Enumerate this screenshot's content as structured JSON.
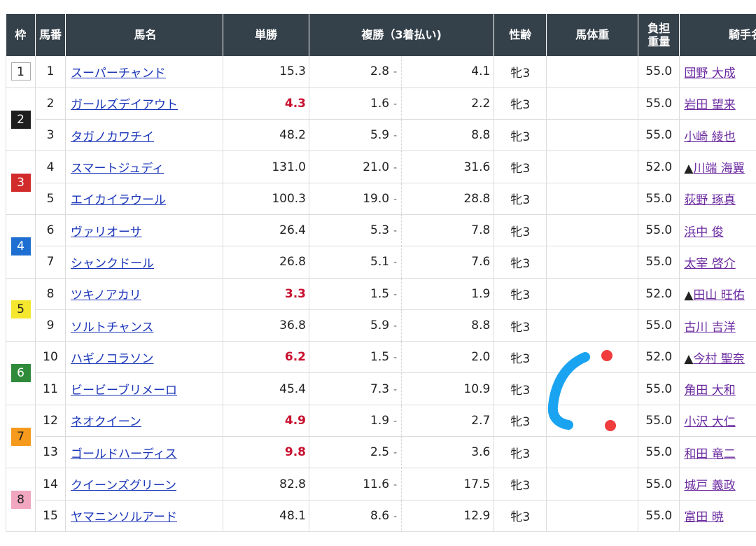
{
  "headers": {
    "waku": "枠",
    "num": "馬番",
    "name": "馬名",
    "win": "単勝",
    "place": "複勝（3着払い)",
    "sex_age": "性齢",
    "body_weight": "馬体重",
    "burden_line1": "負担",
    "burden_line2": "重量",
    "jockey": "騎手名"
  },
  "colors": {
    "header_bg": "#35414a",
    "horse_link": "#1a35b8",
    "jockey_link": "#6b2aa0",
    "favorite_odds": "#c8102e",
    "annotation_blue": "#1aa3f0",
    "annotation_red": "#f03c3c"
  },
  "waku_groups": [
    {
      "label": "1",
      "bg": "#ffffff",
      "fg": "#222222",
      "border": "#aaaaaa",
      "rows": 1
    },
    {
      "label": "2",
      "bg": "#1f1f1f",
      "fg": "#ffffff",
      "border": "none",
      "rows": 2
    },
    {
      "label": "3",
      "bg": "#d12b2b",
      "fg": "#ffffff",
      "border": "none",
      "rows": 2
    },
    {
      "label": "4",
      "bg": "#1e6fd1",
      "fg": "#ffffff",
      "border": "none",
      "rows": 2
    },
    {
      "label": "5",
      "bg": "#f5e62e",
      "fg": "#222222",
      "border": "none",
      "rows": 2
    },
    {
      "label": "6",
      "bg": "#2f8a3a",
      "fg": "#ffffff",
      "border": "none",
      "rows": 2
    },
    {
      "label": "7",
      "bg": "#f59a1c",
      "fg": "#222222",
      "border": "none",
      "rows": 2
    },
    {
      "label": "8",
      "bg": "#f2a7c0",
      "fg": "#222222",
      "border": "none",
      "rows": 2
    }
  ],
  "horses": [
    {
      "num": "1",
      "name": "スーパーチャンド",
      "win": "15.3",
      "fav": false,
      "place_min": "2.8",
      "place_max": "4.1",
      "sex_age": "牝3",
      "weight": "",
      "burden": "55.0",
      "jockey_prefix": "",
      "jockey": "団野 大成"
    },
    {
      "num": "2",
      "name": "ガールズデイアウト",
      "win": "4.3",
      "fav": true,
      "place_min": "1.6",
      "place_max": "2.2",
      "sex_age": "牝3",
      "weight": "",
      "burden": "55.0",
      "jockey_prefix": "",
      "jockey": "岩田 望来"
    },
    {
      "num": "3",
      "name": "タガノカワチイ",
      "win": "48.2",
      "fav": false,
      "place_min": "5.9",
      "place_max": "8.8",
      "sex_age": "牝3",
      "weight": "",
      "burden": "55.0",
      "jockey_prefix": "",
      "jockey": "小崎 綾也"
    },
    {
      "num": "4",
      "name": "スマートジュディ",
      "win": "131.0",
      "fav": false,
      "place_min": "21.0",
      "place_max": "31.6",
      "sex_age": "牝3",
      "weight": "",
      "burden": "52.0",
      "jockey_prefix": "▲",
      "jockey": "川端 海翼"
    },
    {
      "num": "5",
      "name": "エイカイラウール",
      "win": "100.3",
      "fav": false,
      "place_min": "19.0",
      "place_max": "28.8",
      "sex_age": "牝3",
      "weight": "",
      "burden": "55.0",
      "jockey_prefix": "",
      "jockey": "荻野 琢真"
    },
    {
      "num": "6",
      "name": "ヴァリオーサ",
      "win": "26.4",
      "fav": false,
      "place_min": "5.3",
      "place_max": "7.8",
      "sex_age": "牝3",
      "weight": "",
      "burden": "55.0",
      "jockey_prefix": "",
      "jockey": "浜中 俊"
    },
    {
      "num": "7",
      "name": "シャンクドール",
      "win": "26.8",
      "fav": false,
      "place_min": "5.1",
      "place_max": "7.6",
      "sex_age": "牝3",
      "weight": "",
      "burden": "55.0",
      "jockey_prefix": "",
      "jockey": "太宰 啓介"
    },
    {
      "num": "8",
      "name": "ツキノアカリ",
      "win": "3.3",
      "fav": true,
      "place_min": "1.5",
      "place_max": "1.9",
      "sex_age": "牝3",
      "weight": "",
      "burden": "52.0",
      "jockey_prefix": "▲",
      "jockey": "田山 旺佑"
    },
    {
      "num": "9",
      "name": "ソルトチャンス",
      "win": "36.8",
      "fav": false,
      "place_min": "5.9",
      "place_max": "8.8",
      "sex_age": "牝3",
      "weight": "",
      "burden": "55.0",
      "jockey_prefix": "",
      "jockey": "古川 吉洋"
    },
    {
      "num": "10",
      "name": "ハギノコラソン",
      "win": "6.2",
      "fav": true,
      "place_min": "1.5",
      "place_max": "2.0",
      "sex_age": "牝3",
      "weight": "",
      "burden": "52.0",
      "jockey_prefix": "▲",
      "jockey": "今村 聖奈"
    },
    {
      "num": "11",
      "name": "ビービーブリメーロ",
      "win": "45.4",
      "fav": false,
      "place_min": "7.3",
      "place_max": "10.9",
      "sex_age": "牝3",
      "weight": "",
      "burden": "55.0",
      "jockey_prefix": "",
      "jockey": "角田 大和"
    },
    {
      "num": "12",
      "name": "ネオクイーン",
      "win": "4.9",
      "fav": true,
      "place_min": "1.9",
      "place_max": "2.7",
      "sex_age": "牝3",
      "weight": "",
      "burden": "55.0",
      "jockey_prefix": "",
      "jockey": "小沢 大仁"
    },
    {
      "num": "13",
      "name": "ゴールドハーディス",
      "win": "9.8",
      "fav": true,
      "place_min": "2.5",
      "place_max": "3.6",
      "sex_age": "牝3",
      "weight": "",
      "burden": "55.0",
      "jockey_prefix": "",
      "jockey": "和田 竜二"
    },
    {
      "num": "14",
      "name": "クイーンズグリーン",
      "win": "82.8",
      "fav": false,
      "place_min": "11.6",
      "place_max": "17.5",
      "sex_age": "牝3",
      "weight": "",
      "burden": "55.0",
      "jockey_prefix": "",
      "jockey": "城戸 義政"
    },
    {
      "num": "15",
      "name": "ヤマニンソルアード",
      "win": "48.1",
      "fav": false,
      "place_min": "8.6",
      "place_max": "12.9",
      "sex_age": "牝3",
      "weight": "",
      "burden": "55.0",
      "jockey_prefix": "",
      "jockey": "富田 暁"
    }
  ]
}
